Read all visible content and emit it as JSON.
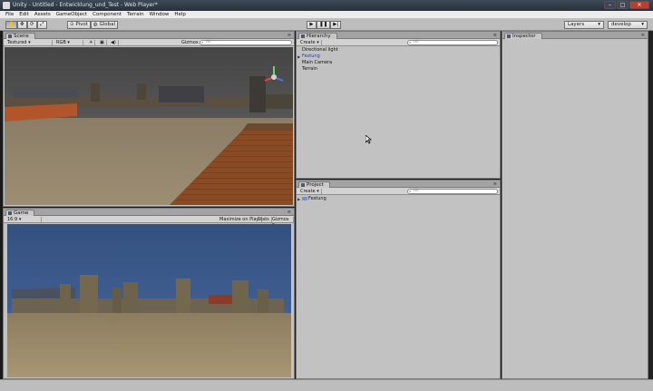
{
  "window": {
    "title": "Unity - Untitled - Entwicklung_und_Test - Web Player*"
  },
  "menu": [
    "File",
    "Edit",
    "Assets",
    "GameObject",
    "Component",
    "Terrain",
    "Window",
    "Help"
  ],
  "toolbar": {
    "pivot_label": "Pivot",
    "global_label": "Global",
    "layers_label": "Layers",
    "layout_label": "develop"
  },
  "scene": {
    "tab_label": "Scene",
    "shading": "Textured",
    "render_mode": "RGB",
    "gizmos_label": "Gizmos",
    "search_placeholder": "All"
  },
  "game": {
    "tab_label": "Game",
    "aspect": "16:9",
    "maximize_label": "Maximize on Play",
    "stats_label": "Stats",
    "gizmos_label": "Gizmos"
  },
  "hierarchy": {
    "tab_label": "Hierarchy",
    "create_label": "Create",
    "search_placeholder": "All",
    "items": [
      {
        "label": "Directional light",
        "selected": false,
        "expandable": false
      },
      {
        "label": "Festung",
        "selected": true,
        "expandable": true
      },
      {
        "label": "Main Camera",
        "selected": false,
        "expandable": false
      },
      {
        "label": "Terrain",
        "selected": false,
        "expandable": false
      }
    ]
  },
  "project": {
    "tab_label": "Project",
    "create_label": "Create",
    "search_placeholder": "All",
    "items": [
      {
        "label": "Festung",
        "icon": "folder-icon"
      }
    ]
  },
  "inspector": {
    "tab_label": "Inspector"
  },
  "colors": {
    "panel_bg": "#c2c2c2",
    "selection": "#23458c",
    "sky": "#3e5e92"
  }
}
